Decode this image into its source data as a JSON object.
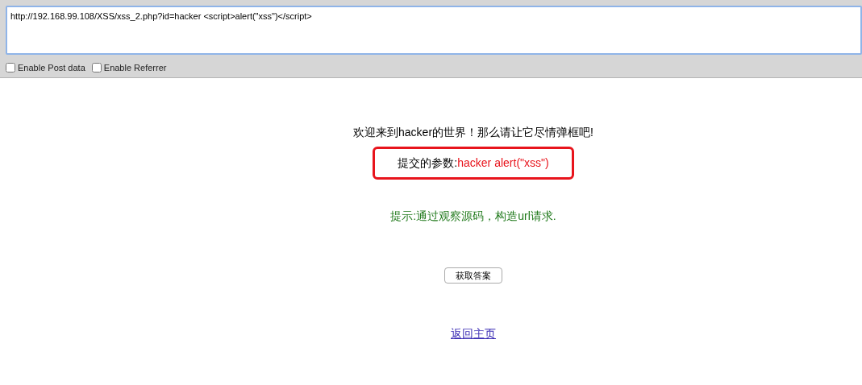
{
  "url_bar": {
    "value": "http://192.168.99.108/XSS/xss_2.php?id=hacker <script>alert(\"xss\")</script>"
  },
  "options": [
    {
      "label": "Enable Post data",
      "checked": false
    },
    {
      "label": "Enable Referrer",
      "checked": false
    }
  ],
  "page": {
    "welcome": "欢迎来到hacker的世界！那么请让它尽情弹框吧!",
    "param_label": "提交的参数:",
    "param_value": "hacker alert(\"xss\")",
    "highlighted": true,
    "hint": "提示:通过观察源码，构造url请求.",
    "answer_button": "获取答案",
    "home_link": "返回主页"
  }
}
